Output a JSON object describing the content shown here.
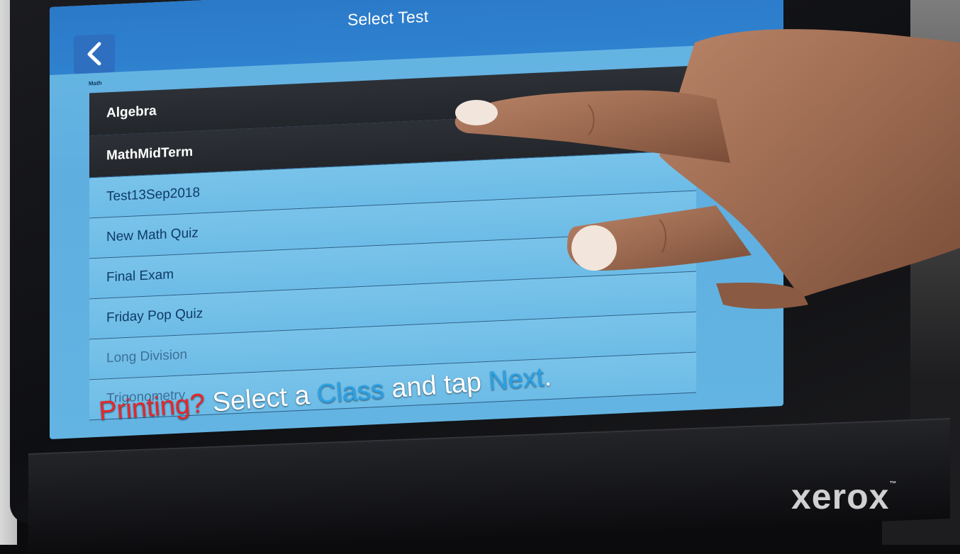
{
  "screen": {
    "title": "Select Test",
    "section_label": "Math",
    "items": [
      {
        "label": "Algebra",
        "selected": true
      },
      {
        "label": "MathMidTerm",
        "selected": true
      },
      {
        "label": "Test13Sep2018",
        "selected": false
      },
      {
        "label": "New Math Quiz",
        "selected": false
      },
      {
        "label": "Final Exam",
        "selected": false
      },
      {
        "label": "Friday Pop Quiz",
        "selected": false
      },
      {
        "label": "Long Division",
        "selected": false
      },
      {
        "label": "Trigonometry",
        "selected": false
      }
    ]
  },
  "caption": {
    "part1": "Printing?",
    "part2": " Select a ",
    "part3": "Class",
    "part4": " and tap ",
    "part5": "Next",
    "part6": "."
  },
  "logo": {
    "text": "xerox",
    "mark": "™"
  },
  "colors": {
    "accent_blue": "#2aa1e6",
    "caption_red": "#e8262b",
    "title_bar": "#2a79c8"
  },
  "icons": [
    "back-chevron-icon",
    "forward-arrow-icon"
  ]
}
